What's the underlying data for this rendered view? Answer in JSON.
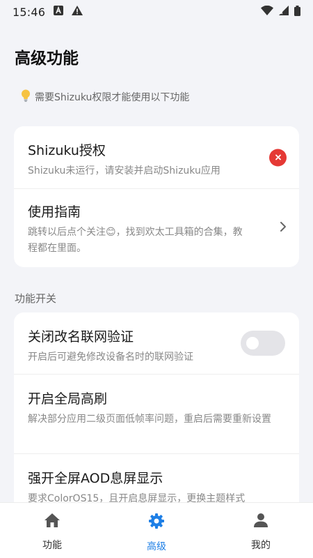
{
  "status_bar": {
    "time": "15:46",
    "icons": [
      "app-a-icon",
      "warning-icon",
      "wifi-icon",
      "signal-icon",
      "battery-icon"
    ]
  },
  "page": {
    "title": "高级功能",
    "hint_icon": "lightbulb-icon",
    "hint": "需要Shizuku权限才能使用以下功能"
  },
  "permissions_card": {
    "auth": {
      "title": "Shizuku授权",
      "desc": "Shizuku未运行，请安装并启动Shizuku应用",
      "status_icon": "error-x-icon"
    },
    "guide": {
      "title": "使用指南",
      "desc": "跳转以后点个关注😊，找到欢太工具箱的合集，教程都在里面。",
      "action_icon": "chevron-right-icon"
    }
  },
  "features": {
    "section_label": "功能开关",
    "rename": {
      "title": "关闭改名联网验证",
      "desc": "开启后可避免修改设备名时的联网验证",
      "enabled": false
    },
    "refresh": {
      "title": "开启全局高刷",
      "desc": "解决部分应用二级页面低帧率问题，重启后需要重新设置"
    },
    "aod": {
      "title": "强开全屏AOD息屏显示",
      "desc": "要求ColorOS15，且开启息屏显示，更换主题样式"
    }
  },
  "bottom_nav": {
    "items": [
      {
        "label": "功能",
        "icon": "home-icon",
        "active": false
      },
      {
        "label": "高级",
        "icon": "gear-icon",
        "active": true
      },
      {
        "label": "我的",
        "icon": "person-icon",
        "active": false
      }
    ]
  },
  "colors": {
    "accent": "#1e7fe6",
    "error": "#e53935",
    "background": "#f3f4f8"
  }
}
